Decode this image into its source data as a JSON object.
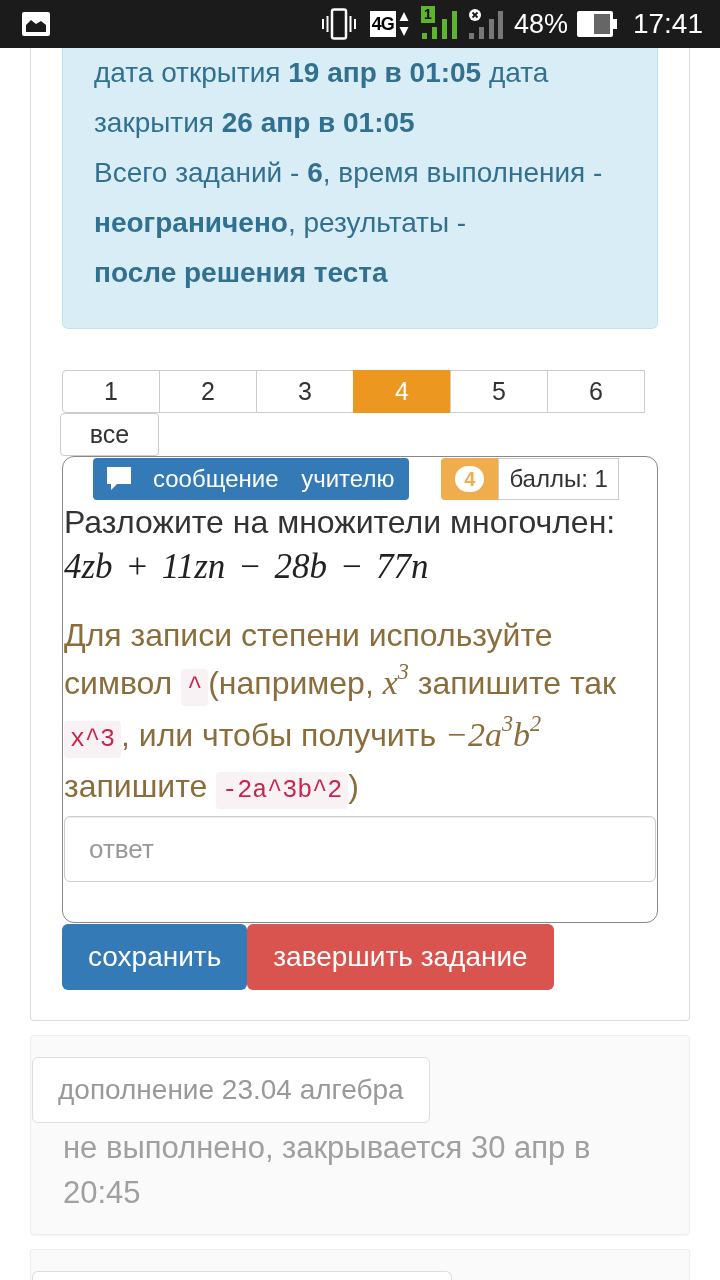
{
  "status_bar": {
    "network_type": "4G",
    "sim_label": "1",
    "battery": "48%",
    "time": "17:41"
  },
  "test_info": {
    "lines": [
      "дата открытия **19 апр в 01:05** дата закрытия **26 апр в 01:05**",
      "Всего заданий - **6**, время выполнения - **неограничено**, результаты - **после решения теста**"
    ]
  },
  "pagination": {
    "pages": [
      {
        "label": "1",
        "selected": false
      },
      {
        "label": "2",
        "selected": false
      },
      {
        "label": "3",
        "selected": false
      },
      {
        "label": "4",
        "selected": true
      },
      {
        "label": "5",
        "selected": false
      },
      {
        "label": "6",
        "selected": false
      }
    ],
    "all_label": "все"
  },
  "question": {
    "message_button": "сообщение учителю",
    "number": "4",
    "points": "баллы: 1",
    "prompt": "Разложите на множители многочлен:",
    "expression": "4zb + 11zn − 28b − 77n",
    "hint": [
      {
        "kind": "text",
        "text": "Для записи степени используйте символ "
      },
      {
        "kind": "code",
        "text": "^"
      },
      {
        "kind": "text",
        "text": "(например, "
      },
      {
        "kind": "math",
        "text": "x$^{3}$"
      },
      {
        "kind": "text",
        "text": " запишите так "
      },
      {
        "kind": "code",
        "text": "x^3"
      },
      {
        "kind": "text",
        "text": ", или чтобы получить "
      },
      {
        "kind": "math",
        "text": "−2a$^{3}$b$^{2}$"
      },
      {
        "kind": "text",
        "text": " запишите "
      },
      {
        "kind": "code",
        "text": "-2a^3b^2"
      },
      {
        "kind": "text",
        "text": ")"
      }
    ],
    "answer": {
      "placeholder": "ответ"
    }
  },
  "actions": [
    {
      "kind": "primary",
      "label": "сохранить"
    },
    {
      "kind": "danger",
      "label": "завершить задание"
    }
  ],
  "tasks": [
    {
      "title": "дополнение 23.04 алгебра",
      "status": "не выполнено, закрывается 30 апр в 20:45"
    }
  ]
}
